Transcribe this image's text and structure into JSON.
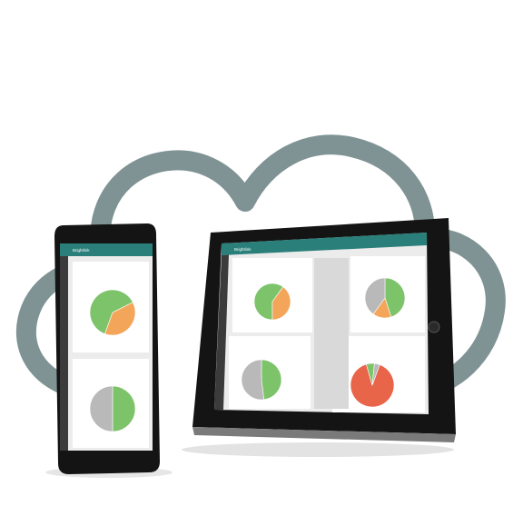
{
  "scene": {
    "colors": {
      "cloud": "#7f9294",
      "device_body": "#151515",
      "screen_bg": "#ececec",
      "app_header": "#2a7f7a",
      "sidebar": "#3b3b3b",
      "pie_green": "#7cc36a",
      "pie_orange": "#f3a65a",
      "pie_gray": "#b9b9b9",
      "pie_red": "#e9654a"
    }
  },
  "tablet": {
    "header_text": "Brightlink",
    "panels": [
      {
        "title": "",
        "slices": [
          {
            "label": "green",
            "value": 0.6,
            "color": "#7cc36a"
          },
          {
            "label": "orange",
            "value": 0.4,
            "color": "#f3a65a"
          }
        ]
      },
      {
        "title": "",
        "slices": [
          {
            "label": "green",
            "value": 0.45,
            "color": "#7cc36a"
          },
          {
            "label": "orange",
            "value": 0.15,
            "color": "#f3a65a"
          },
          {
            "label": "gray",
            "value": 0.4,
            "color": "#b9b9b9"
          }
        ]
      },
      {
        "title": "",
        "slices": [
          {
            "label": "green",
            "value": 0.48,
            "color": "#7cc36a"
          },
          {
            "label": "gray",
            "value": 0.52,
            "color": "#b9b9b9"
          }
        ]
      },
      {
        "title": "",
        "slices": [
          {
            "label": "red",
            "value": 0.9,
            "color": "#e9654a"
          },
          {
            "label": "green",
            "value": 0.06,
            "color": "#7cc36a"
          },
          {
            "label": "gray",
            "value": 0.04,
            "color": "#b9b9b9"
          }
        ]
      }
    ]
  },
  "phone": {
    "header_text": "Brightlink",
    "panels": [
      {
        "title": "",
        "slices": [
          {
            "label": "green",
            "value": 0.62,
            "color": "#7cc36a"
          },
          {
            "label": "orange",
            "value": 0.38,
            "color": "#f3a65a"
          }
        ]
      },
      {
        "title": "",
        "slices": [
          {
            "label": "green",
            "value": 0.5,
            "color": "#7cc36a"
          },
          {
            "label": "gray",
            "value": 0.5,
            "color": "#b9b9b9"
          }
        ]
      }
    ]
  }
}
